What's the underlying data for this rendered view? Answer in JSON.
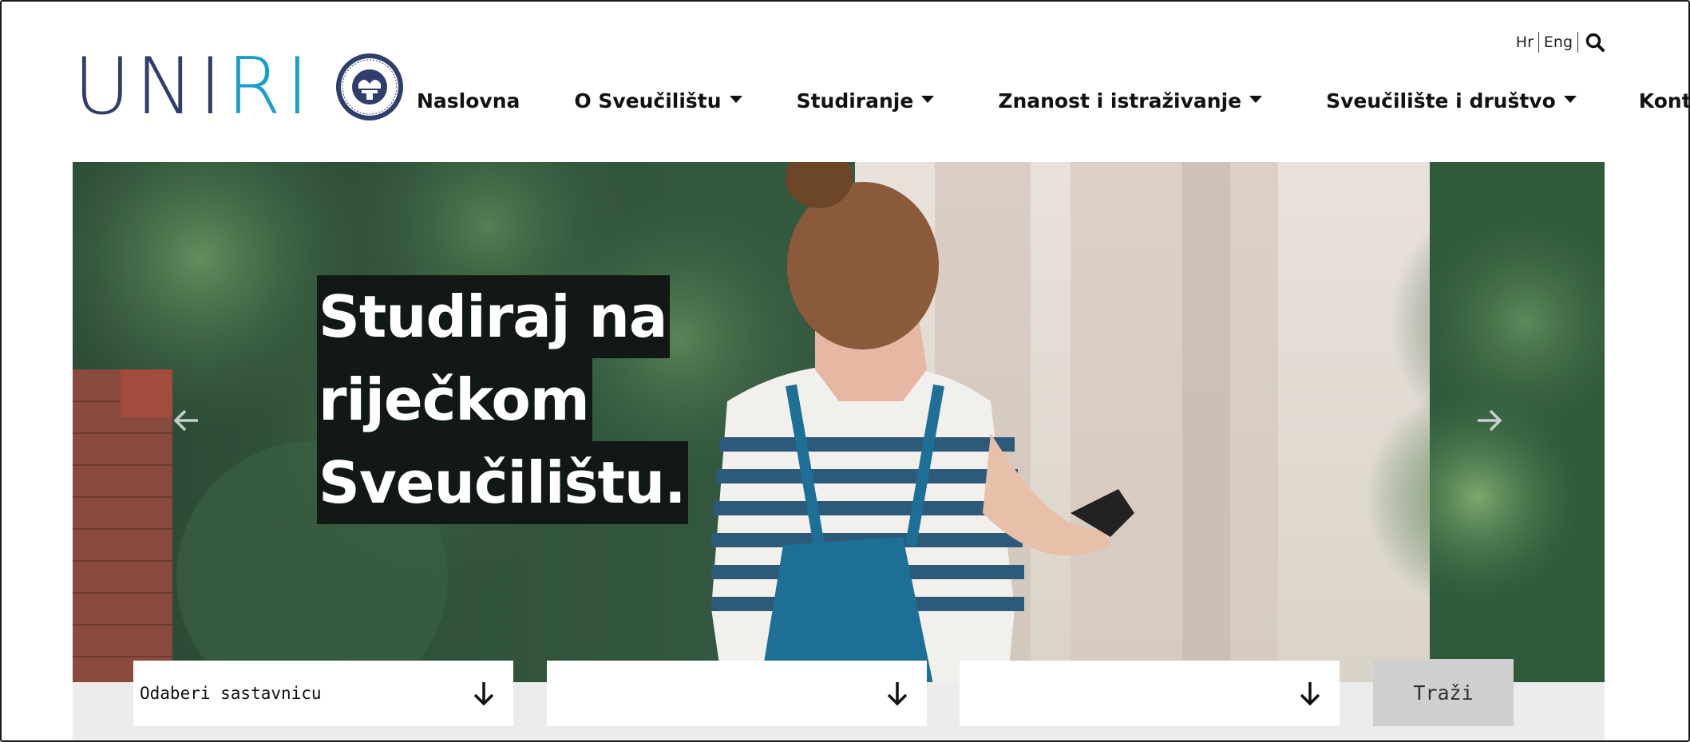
{
  "brand": {
    "logo_text_dark": "UNI",
    "logo_text_accent": "RI",
    "colors": {
      "dark": "#2f3e6b",
      "accent": "#1aa0c8"
    }
  },
  "header": {
    "languages": [
      "Hr",
      "Eng"
    ],
    "search_icon": "search-icon"
  },
  "nav": {
    "items": [
      {
        "label": "Naslovna",
        "dropdown": false
      },
      {
        "label": "O Sveučilištu",
        "dropdown": true
      },
      {
        "label": "Studiranje",
        "dropdown": true
      },
      {
        "label": "Znanost i istraživanje",
        "dropdown": true
      },
      {
        "label": "Sveučilište i društvo",
        "dropdown": true
      },
      {
        "label": "Kontakt",
        "dropdown": false
      }
    ]
  },
  "hero": {
    "headline_lines": [
      "Studiraj na",
      "riječkom",
      "Sveučilištu."
    ],
    "prev_icon": "arrow-left-icon",
    "next_icon": "arrow-right-icon"
  },
  "filters": {
    "selects": [
      {
        "value": "Odaberi sastavnicu",
        "icon": "arrow-down-icon"
      },
      {
        "value": "",
        "icon": "arrow-down-icon"
      },
      {
        "value": "",
        "icon": "arrow-down-icon"
      }
    ],
    "search_button": "Traži"
  }
}
